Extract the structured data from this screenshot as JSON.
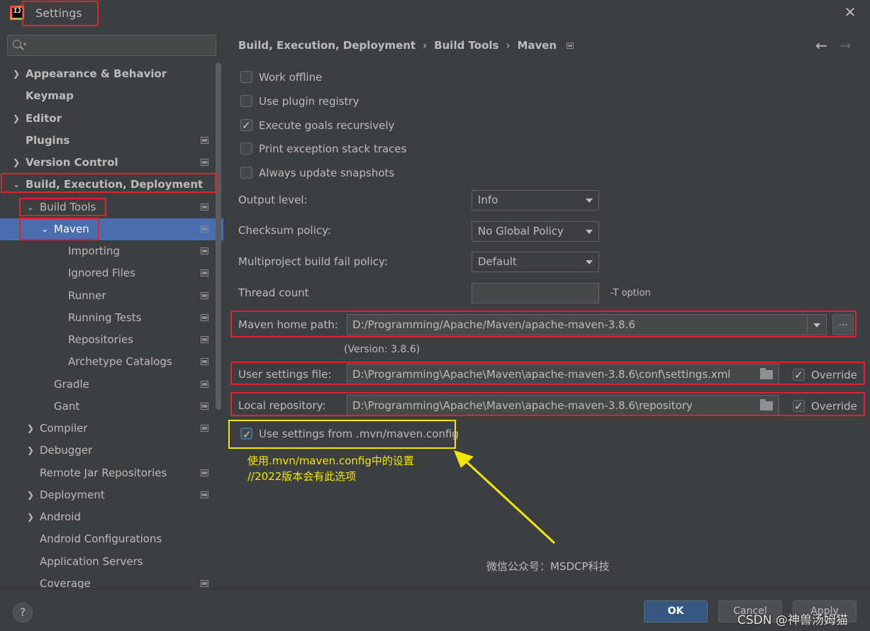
{
  "window": {
    "title": "Settings"
  },
  "search": {
    "placeholder": ""
  },
  "sidebar": {
    "items": [
      {
        "label": "Appearance & Behavior"
      },
      {
        "label": "Keymap"
      },
      {
        "label": "Editor"
      },
      {
        "label": "Plugins"
      },
      {
        "label": "Version Control"
      },
      {
        "label": "Build, Execution, Deployment"
      },
      {
        "label": "Build Tools"
      },
      {
        "label": "Maven"
      },
      {
        "label": "Importing"
      },
      {
        "label": "Ignored Files"
      },
      {
        "label": "Runner"
      },
      {
        "label": "Running Tests"
      },
      {
        "label": "Repositories"
      },
      {
        "label": "Archetype Catalogs"
      },
      {
        "label": "Gradle"
      },
      {
        "label": "Gant"
      },
      {
        "label": "Compiler"
      },
      {
        "label": "Debugger"
      },
      {
        "label": "Remote Jar Repositories"
      },
      {
        "label": "Deployment"
      },
      {
        "label": "Android"
      },
      {
        "label": "Android Configurations"
      },
      {
        "label": "Application Servers"
      },
      {
        "label": "Coverage"
      }
    ]
  },
  "breadcrumb": {
    "parts": [
      "Build, Execution, Deployment",
      "Build Tools",
      "Maven"
    ],
    "separator": "›"
  },
  "nav": {
    "back": "←",
    "forward": "→"
  },
  "checkboxes": {
    "work_offline": {
      "label": "Work offline",
      "checked": false
    },
    "plugin_registry": {
      "label": "Use plugin registry",
      "checked": false
    },
    "execute_goals": {
      "label": "Execute goals recursively",
      "checked": true
    },
    "print_exception": {
      "label": "Print exception stack traces",
      "checked": false
    },
    "always_update": {
      "label": "Always update snapshots",
      "checked": false
    },
    "use_mvn_config": {
      "label": "Use settings from .mvn/maven.config",
      "checked": true
    }
  },
  "fields": {
    "output_level": {
      "label": "Output level:",
      "value": "Info"
    },
    "checksum_policy": {
      "label": "Checksum policy:",
      "value": "No Global Policy"
    },
    "fail_policy": {
      "label": "Multiproject build fail policy:",
      "value": "Default"
    },
    "thread_count": {
      "label": "Thread count",
      "value": "",
      "note": "-T option"
    },
    "maven_home": {
      "label": "Maven home path:",
      "value": "D:/Programming/Apache/Maven/apache-maven-3.8.6",
      "browse": "...",
      "version": "(Version: 3.8.6)"
    },
    "user_settings": {
      "label": "User settings file:",
      "value": "D:\\Programming\\Apache\\Maven\\apache-maven-3.8.6\\conf\\settings.xml",
      "override_label": "Override",
      "override_checked": true
    },
    "local_repo": {
      "label": "Local repository:",
      "value": "D:\\Programming\\Apache\\Maven\\apache-maven-3.8.6\\repository",
      "override_label": "Override",
      "override_checked": true
    }
  },
  "annotation": {
    "line1": "使用.mvn/maven.config中的设置",
    "line2": "//2022版本会有此选项",
    "wechat": "微信公众号：MSDCP科技"
  },
  "buttons": {
    "help": "?",
    "ok": "OK",
    "cancel": "Cancel",
    "apply": "Apply"
  },
  "watermark": "CSDN @神兽汤姆猫",
  "colors": {
    "highlight_red": "#e3212b",
    "annotation_yellow": "#f5e600",
    "selection": "#4b6eaf"
  }
}
